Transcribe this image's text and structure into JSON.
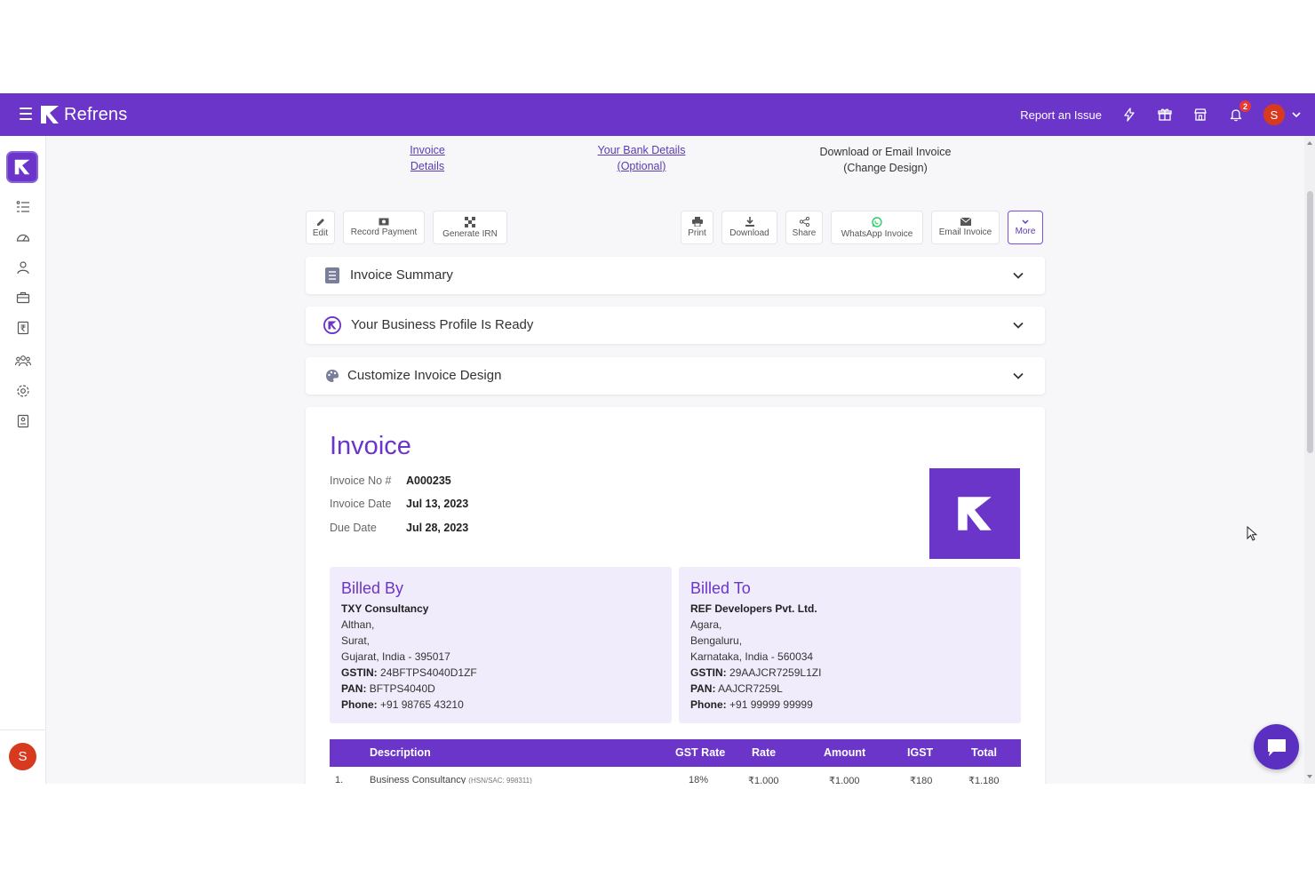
{
  "app": {
    "brand": "Refrens"
  },
  "topbar": {
    "report_issue": "Report an Issue",
    "notification_count": "2",
    "avatar_initial": "S"
  },
  "sidebar": {
    "avatar_initial": "S"
  },
  "steps": {
    "invoice_details": "Invoice Details",
    "bank_details": "Your Bank Details",
    "bank_optional": "(Optional)",
    "download_email": "Download or Email Invoice",
    "change_design": "(Change Design)"
  },
  "toolbar": {
    "edit": "Edit",
    "record_payment": "Record Payment",
    "generate_irn": "Generate IRN",
    "print": "Print",
    "download": "Download",
    "share": "Share",
    "whatsapp": "WhatsApp Invoice",
    "email": "Email Invoice",
    "more": "More"
  },
  "accordions": {
    "summary": "Invoice Summary",
    "business_profile": "Your Business Profile Is Ready",
    "customize": "Customize Invoice Design"
  },
  "invoice": {
    "title": "Invoice",
    "no_label": "Invoice No #",
    "no_value": "A000235",
    "date_label": "Invoice Date",
    "date_value": "Jul 13, 2023",
    "due_label": "Due Date",
    "due_value": "Jul 28, 2023"
  },
  "billed_by": {
    "heading": "Billed By",
    "name": "TXY Consultancy",
    "line1": "Althan,",
    "line2": "Surat,",
    "line3": "Gujarat, India - 395017",
    "gstin_label": "GSTIN:",
    "gstin": "24BFTPS4040D1ZF",
    "pan_label": "PAN:",
    "pan": "BFTPS4040D",
    "phone_label": "Phone:",
    "phone": "+91 98765 43210"
  },
  "billed_to": {
    "heading": "Billed To",
    "name": "REF Developers Pvt. Ltd.",
    "line1": "Agara,",
    "line2": "Bengaluru,",
    "line3": "Karnataka, India - 560034",
    "gstin_label": "GSTIN:",
    "gstin": "29AAJCR7259L1ZI",
    "pan_label": "PAN:",
    "pan": "AAJCR7259L",
    "phone_label": "Phone:",
    "phone": "+91 99999 99999"
  },
  "table": {
    "headers": [
      "Description",
      "GST Rate",
      "Rate",
      "Amount",
      "IGST",
      "Total"
    ],
    "rows": [
      {
        "no": "1.",
        "description": "Business Consultancy",
        "hsn": "(HSN/SAC: 998311)",
        "gst_rate": "18%",
        "rate": "₹1,000",
        "amount": "₹1,000",
        "igst": "₹180",
        "total": "₹1,180"
      }
    ]
  },
  "colors": {
    "brand": "#6a35c8",
    "accent_light": "#f1ecfb",
    "avatar": "#d83a1f",
    "whatsapp": "#25d366"
  }
}
